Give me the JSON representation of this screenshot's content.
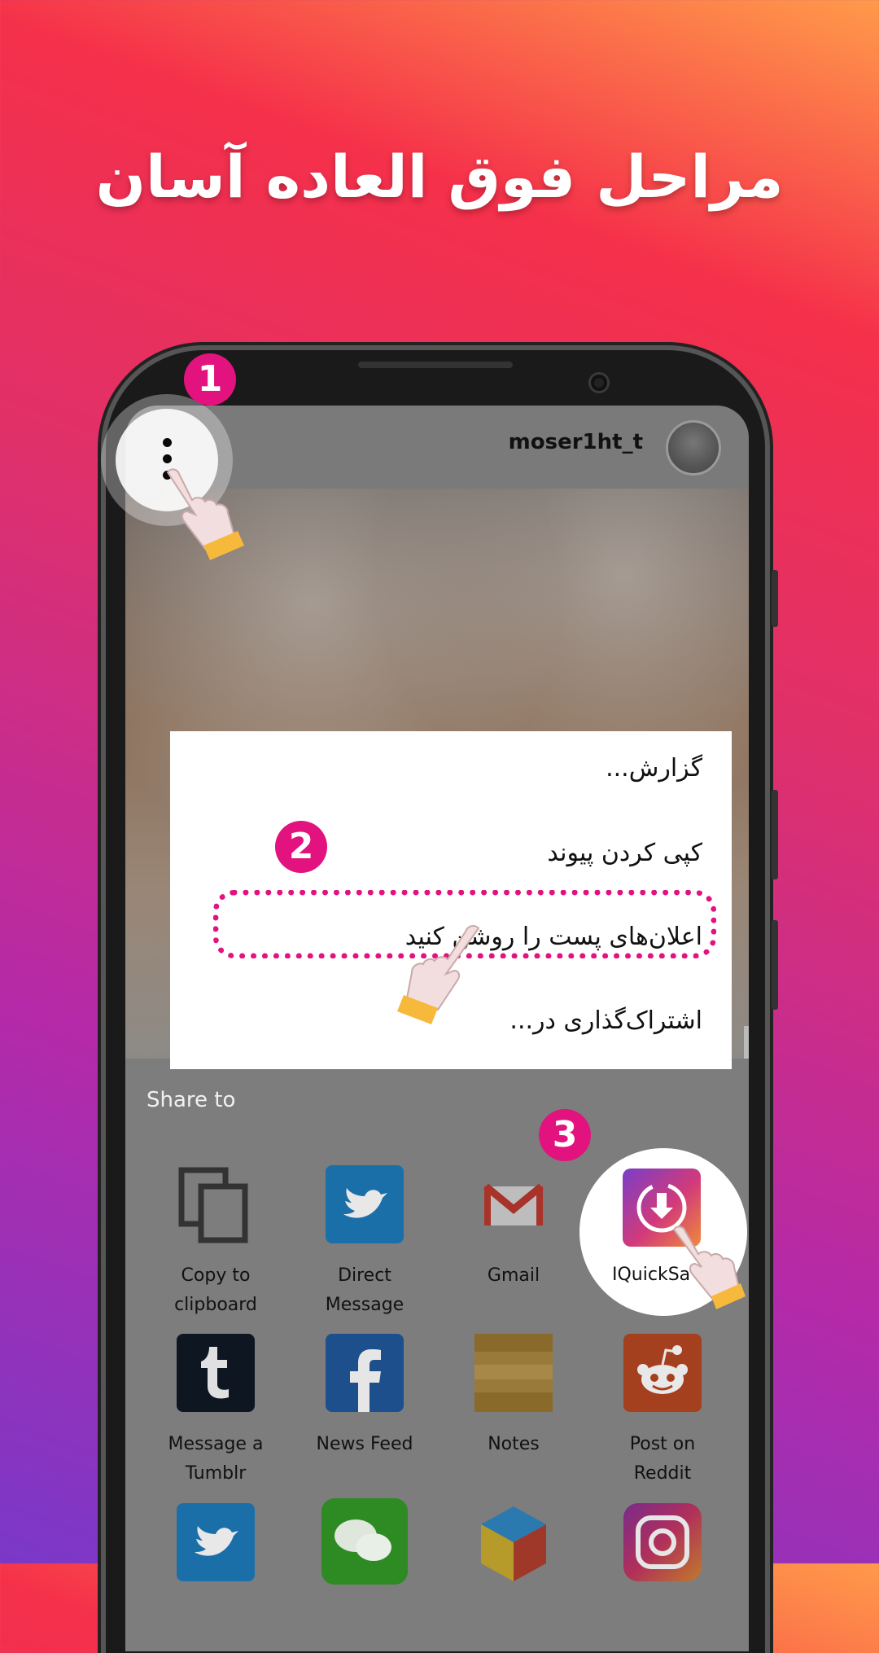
{
  "headline": "مراحل فوق العاده آسان",
  "steps": [
    "1",
    "2",
    "3"
  ],
  "post_header": {
    "username": "moser1ht_t"
  },
  "menu": {
    "items": [
      "گزارش...",
      "کپی کردن پیوند",
      "اعلان‌های پست را روشن کنید",
      "اشتراک‌گذاری در..."
    ]
  },
  "share_sheet": {
    "title": "Share to",
    "apps": [
      {
        "label_line1": "Copy to",
        "label_line2": "clipboard",
        "icon": "copy-icon"
      },
      {
        "label_line1": "Direct",
        "label_line2": "Message",
        "icon": "twitter-icon"
      },
      {
        "label_line1": "Gmail",
        "label_line2": "",
        "icon": "gmail-icon"
      },
      {
        "label_line1": "IQuickSa",
        "label_line2": "",
        "icon": "iquicksave-icon"
      },
      {
        "label_line1": "Message a",
        "label_line2": "Tumblr",
        "icon": "tumblr-icon"
      },
      {
        "label_line1": "News Feed",
        "label_line2": "",
        "icon": "facebook-icon"
      },
      {
        "label_line1": "Notes",
        "label_line2": "",
        "icon": "notes-icon"
      },
      {
        "label_line1": "Post on",
        "label_line2": "Reddit",
        "icon": "reddit-icon"
      }
    ],
    "partial_row_icons": [
      "twitter-icon",
      "wechat-icon",
      "box-icon",
      "instagram-icon"
    ]
  },
  "colors": {
    "accent": "#e2137e",
    "hand_cuff": "#f6b93b"
  }
}
